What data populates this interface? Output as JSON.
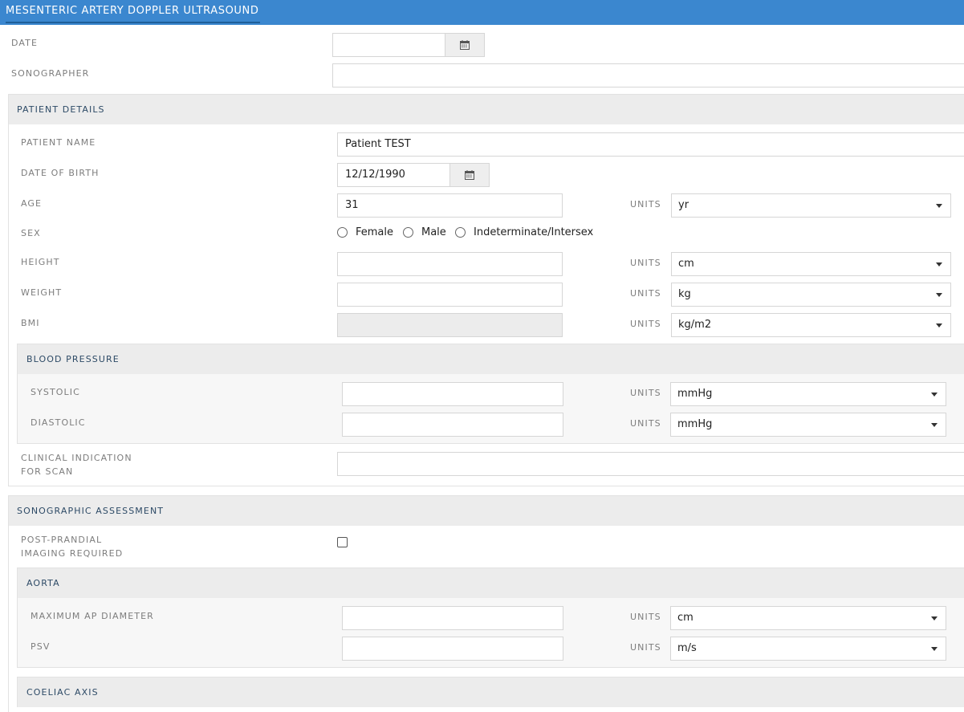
{
  "form": {
    "title": "MESENTERIC ARTERY DOPPLER ULTRASOUND"
  },
  "top": {
    "date_label": "DATE",
    "date_value": "",
    "sonographer_label": "SONOGRAPHER",
    "sonographer_value": ""
  },
  "patient": {
    "header": "PATIENT DETAILS",
    "name_label": "PATIENT NAME",
    "name_value": "Patient TEST",
    "dob_label": "DATE OF BIRTH",
    "dob_value": "12/12/1990",
    "age_label": "AGE",
    "age_value": "31",
    "age_units": "yr",
    "sex_label": "SEX",
    "sex_options": [
      "Female",
      "Male",
      "Indeterminate/Intersex"
    ],
    "height_label": "HEIGHT",
    "height_value": "",
    "height_units": "cm",
    "weight_label": "WEIGHT",
    "weight_value": "",
    "weight_units": "kg",
    "bmi_label": "BMI",
    "bmi_value": "",
    "bmi_units": "kg/m2",
    "units_label": "UNITS",
    "bp": {
      "header": "BLOOD PRESSURE",
      "systolic_label": "SYSTOLIC",
      "systolic_value": "",
      "systolic_units": "mmHg",
      "diastolic_label": "DIASTOLIC",
      "diastolic_value": "",
      "diastolic_units": "mmHg"
    },
    "clinical_label_line1": "CLINICAL INDICATION",
    "clinical_label_line2": "FOR SCAN",
    "clinical_value": ""
  },
  "sono": {
    "header": "SONOGRAPHIC ASSESSMENT",
    "postprandial_label_line1": "POST-PRANDIAL",
    "postprandial_label_line2": "IMAGING REQUIRED",
    "postprandial_checked": false,
    "aorta": {
      "header": "AORTA",
      "max_ap_label": "MAXIMUM AP DIAMETER",
      "max_ap_value": "",
      "max_ap_units": "cm",
      "psv_label": "PSV",
      "psv_value": "",
      "psv_units": "m/s"
    },
    "coeliac_header": "COELIAC AXIS"
  },
  "icons": {
    "calendar": "calendar-icon",
    "dropdown": "caret-down-icon"
  },
  "colors": {
    "title_bar": "#3b87cf",
    "section_header": "#ececec"
  }
}
